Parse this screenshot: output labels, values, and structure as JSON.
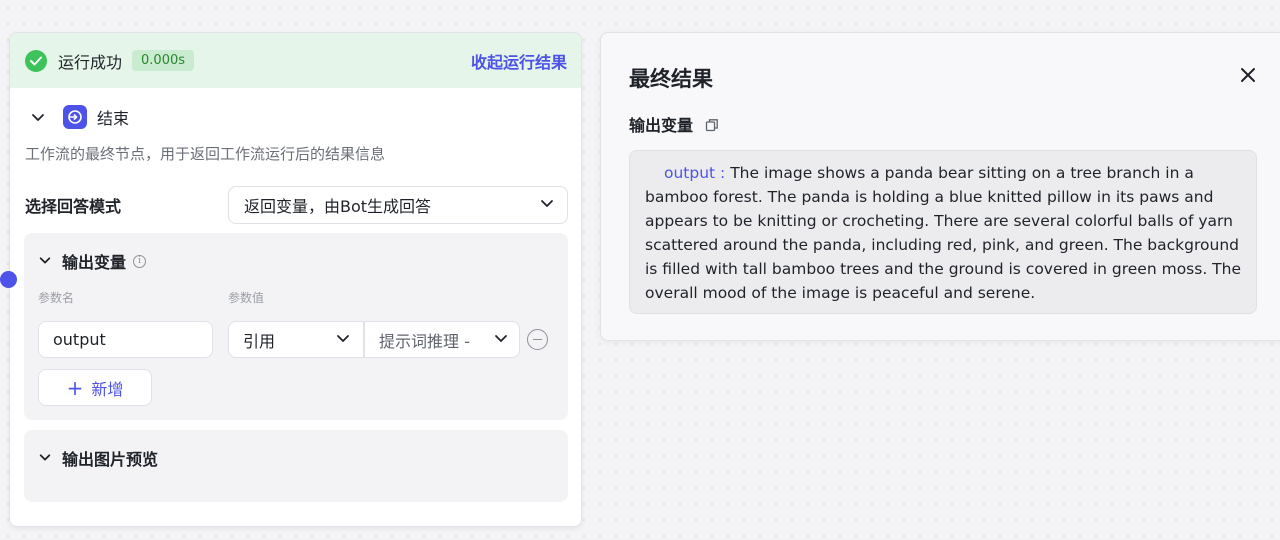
{
  "run": {
    "status": "运行成功",
    "time": "0.000s",
    "collapse_label": "收起运行结果"
  },
  "node": {
    "title": "结束",
    "description": "工作流的最终节点，用于返回工作流运行后的结果信息"
  },
  "answer_mode": {
    "label": "选择回答模式",
    "value": "返回变量，由Bot生成回答"
  },
  "output_vars": {
    "title": "输出变量",
    "col_name": "参数名",
    "col_value": "参数值",
    "rows": [
      {
        "name": "output",
        "type": "引用",
        "source": "提示词推理 -"
      }
    ],
    "add_label": "新增"
  },
  "image_preview": {
    "title": "输出图片预览"
  },
  "result": {
    "title": "最终结果",
    "section_label": "输出变量",
    "output_key": "output :",
    "output_text": "The image shows a panda bear sitting on a tree branch in a bamboo forest. The panda is holding a blue knitted pillow in its paws and appears to be knitting or crocheting. There are several colorful balls of yarn scattered around the panda, including red, pink, and green. The background is filled with tall bamboo trees and the ground is covered in green moss. The overall mood of the image is peaceful and serene."
  },
  "colors": {
    "accent": "#4d53e8",
    "success": "#3ec25a",
    "success_bg": "#e6f5e9"
  }
}
